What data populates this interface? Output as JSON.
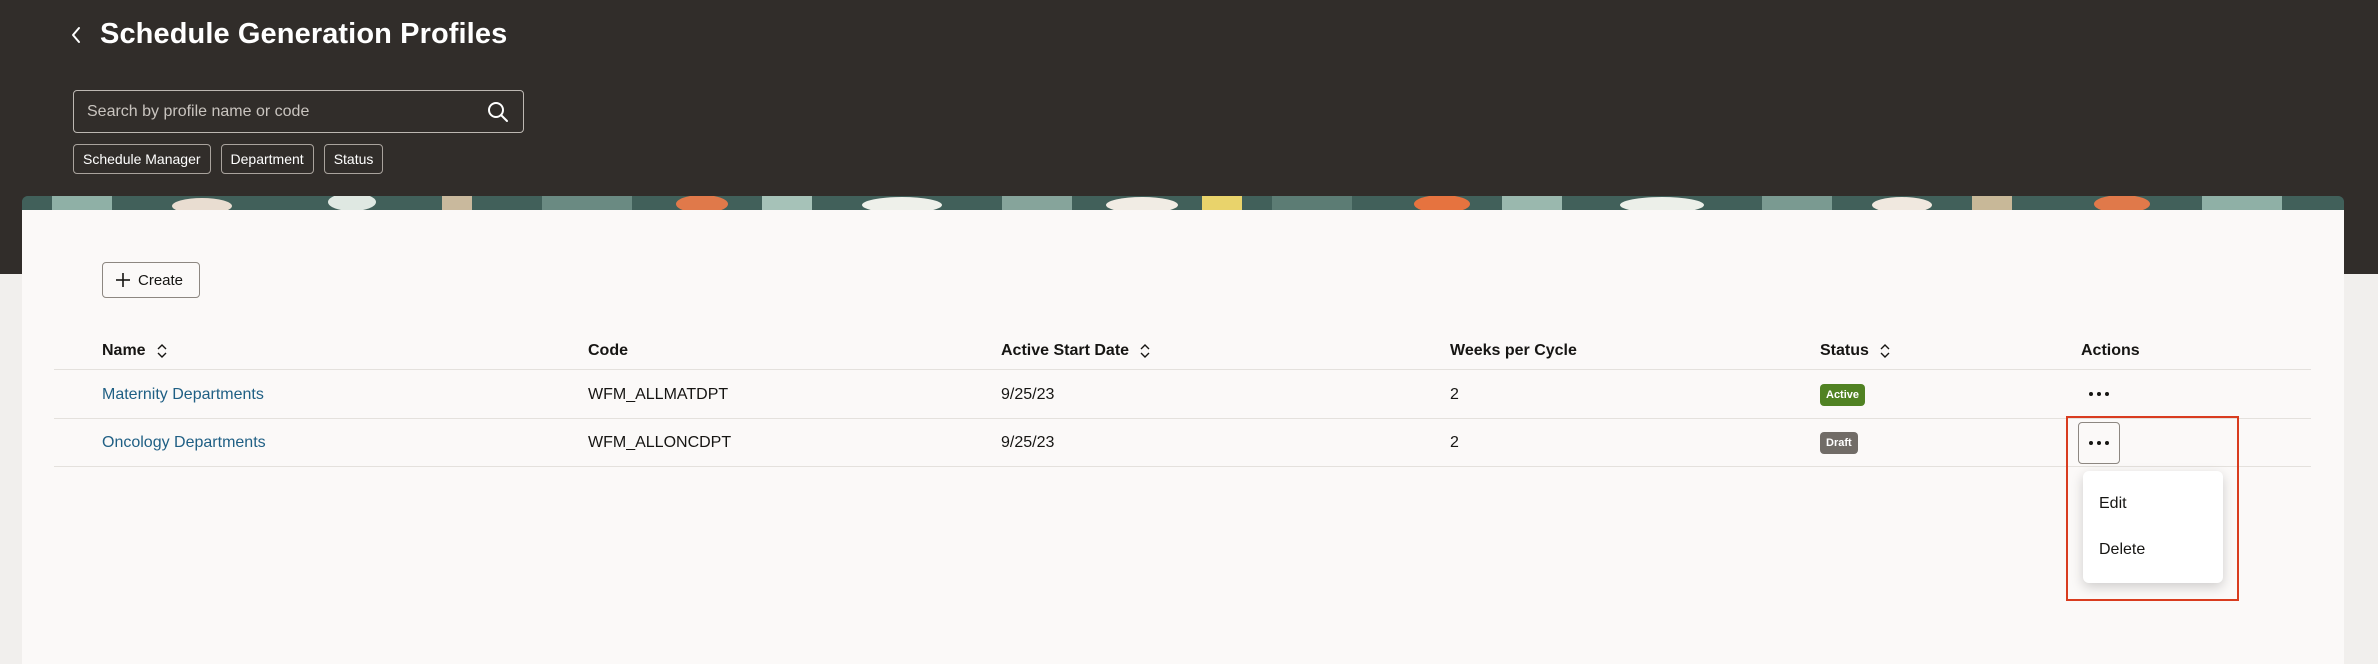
{
  "header": {
    "title": "Schedule Generation Profiles",
    "back_icon": "chevron-left-icon"
  },
  "search": {
    "placeholder": "Search by profile name or code",
    "value": "",
    "icon": "search-icon"
  },
  "filters": [
    "Schedule Manager",
    "Department",
    "Status"
  ],
  "toolbar": {
    "create_label": "Create"
  },
  "table": {
    "columns": {
      "name": "Name",
      "code": "Code",
      "start": "Active Start Date",
      "weeks": "Weeks per Cycle",
      "status": "Status",
      "actions": "Actions"
    },
    "rows": [
      {
        "name": "Maternity Departments",
        "code": "WFM_ALLMATDPT",
        "start": "9/25/23",
        "weeks": "2",
        "status": "Active"
      },
      {
        "name": "Oncology Departments",
        "code": "WFM_ALLONCDPT",
        "start": "9/25/23",
        "weeks": "2",
        "status": "Draft"
      }
    ]
  },
  "actions_menu": {
    "items": [
      "Edit",
      "Delete"
    ]
  },
  "colors": {
    "header_bg": "#312d2a",
    "link": "#1f5f84",
    "active_badge": "#508223",
    "draft_badge": "#716c67",
    "highlight": "#d93c1f"
  }
}
